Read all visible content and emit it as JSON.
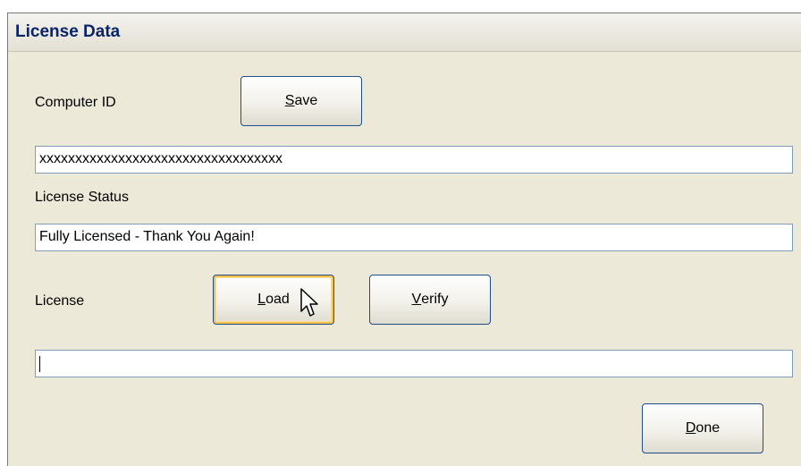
{
  "dialog": {
    "title": "License Data"
  },
  "computer_id": {
    "label": "Computer ID",
    "save_button": {
      "mnemonic": "S",
      "rest": "ave"
    },
    "value": "xxxxxxxxxxxxxxxxxxxxxxxxxxxxxxxxxx"
  },
  "license_status": {
    "label": "License Status",
    "value": "Fully Licensed - Thank You Again!"
  },
  "license": {
    "label": "License",
    "load_button": {
      "mnemonic": "L",
      "rest": "oad"
    },
    "verify_button": {
      "mnemonic": "V",
      "rest": "erify"
    },
    "value": ""
  },
  "done_button": {
    "mnemonic": "D",
    "rest": "one"
  },
  "icons": {
    "cursor": "arrow-cursor-icon"
  }
}
